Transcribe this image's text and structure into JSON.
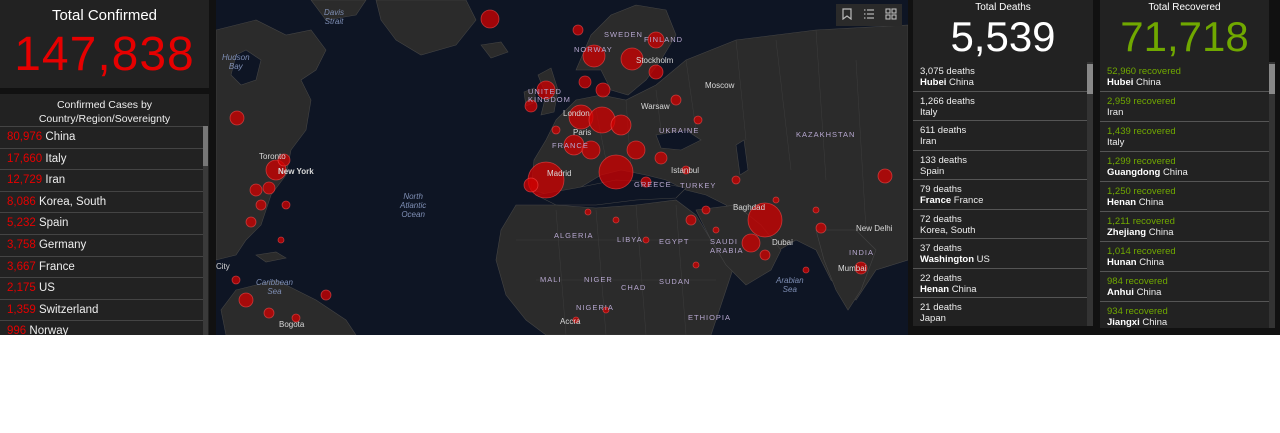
{
  "total_confirmed": {
    "title": "Total Confirmed",
    "value": "147,838"
  },
  "country_panel": {
    "title_line1": "Confirmed Cases by",
    "title_line2": "Country/Region/Sovereignty",
    "rows": [
      {
        "count": "80,976",
        "name": "China"
      },
      {
        "count": "17,660",
        "name": "Italy"
      },
      {
        "count": "12,729",
        "name": "Iran"
      },
      {
        "count": "8,086",
        "name": "Korea, South"
      },
      {
        "count": "5,232",
        "name": "Spain"
      },
      {
        "count": "3,758",
        "name": "Germany"
      },
      {
        "count": "3,667",
        "name": "France"
      },
      {
        "count": "2,175",
        "name": "US"
      },
      {
        "count": "1,359",
        "name": "Switzerland"
      },
      {
        "count": "996",
        "name": "Norway"
      }
    ]
  },
  "map": {
    "oceans": {
      "davis": "Davis\nStrait",
      "hudson": "Hudson\nBay",
      "atlantic": "North\nAtlantic\nOcean",
      "caribbean": "Caribbean\nSea",
      "arabian": "Arabian\nSea"
    },
    "countries": [
      "SWEDEN",
      "FINLAND",
      "NORWAY",
      "UNITED KINGDOM",
      "FRANCE",
      "UKRAINE",
      "KAZAKHSTAN",
      "TURKEY",
      "GREECE",
      "ALGERIA",
      "LIBYA",
      "EGYPT",
      "SAUDI ARABIA",
      "MALI",
      "NIGER",
      "CHAD",
      "SUDAN",
      "NIGERIA",
      "ETHIOPIA",
      "INDIA"
    ],
    "cities": [
      "Stockholm",
      "Moscow",
      "Warsaw",
      "London",
      "Paris",
      "Madrid",
      "Istanbul",
      "Baghdad",
      "Dubai",
      "New Delhi",
      "Mumbai",
      "Toronto",
      "New York",
      "Bogota",
      "Accra",
      "City"
    ]
  },
  "deaths": {
    "title": "Total Deaths",
    "value": "5,539",
    "rows": [
      {
        "count": "3,075 deaths",
        "place": "Hubei",
        "country": "China"
      },
      {
        "count": "1,266 deaths",
        "place": "",
        "country": "Italy"
      },
      {
        "count": "611 deaths",
        "place": "",
        "country": "Iran"
      },
      {
        "count": "133 deaths",
        "place": "",
        "country": "Spain"
      },
      {
        "count": "79 deaths",
        "place": "France",
        "country": "France"
      },
      {
        "count": "72 deaths",
        "place": "",
        "country": "Korea, South"
      },
      {
        "count": "37 deaths",
        "place": "Washington",
        "country": "US"
      },
      {
        "count": "22 deaths",
        "place": "Henan",
        "country": "China"
      },
      {
        "count": "21 deaths",
        "place": "",
        "country": "Japan"
      }
    ]
  },
  "recovered": {
    "title": "Total Recovered",
    "value": "71,718",
    "rows": [
      {
        "count": "52,960 recovered",
        "place": "Hubei",
        "country": "China"
      },
      {
        "count": "2,959 recovered",
        "place": "",
        "country": "Iran"
      },
      {
        "count": "1,439 recovered",
        "place": "",
        "country": "Italy"
      },
      {
        "count": "1,299 recovered",
        "place": "Guangdong",
        "country": "China"
      },
      {
        "count": "1,250 recovered",
        "place": "Henan",
        "country": "China"
      },
      {
        "count": "1,211 recovered",
        "place": "Zhejiang",
        "country": "China"
      },
      {
        "count": "1,014 recovered",
        "place": "Hunan",
        "country": "China"
      },
      {
        "count": "984 recovered",
        "place": "Anhui",
        "country": "China"
      },
      {
        "count": "934 recovered",
        "place": "Jiangxi",
        "country": "China"
      }
    ]
  },
  "colors": {
    "confirmed": "#e60000",
    "recovered": "#70a800",
    "panel": "#222222",
    "map_bg": "#0e1524"
  },
  "icons": [
    "bookmark-icon",
    "list-icon",
    "qr-grid-icon"
  ]
}
